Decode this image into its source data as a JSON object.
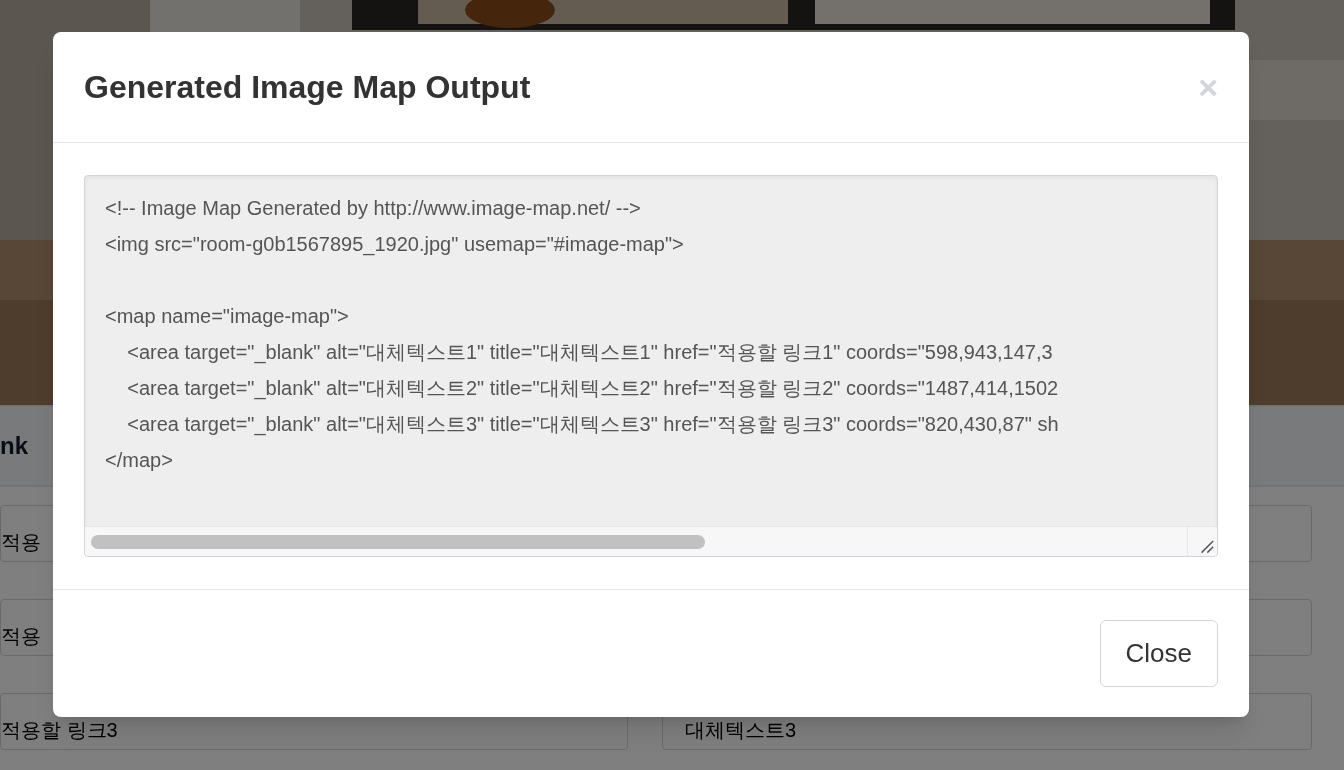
{
  "page": {
    "heading": "nk",
    "rows": [
      {
        "link": "적용",
        "alt": ""
      },
      {
        "link": "적용",
        "alt": ""
      },
      {
        "link": "적용할 링크3",
        "alt": "대체텍스트3"
      }
    ]
  },
  "modal": {
    "title": "Generated Image Map Output",
    "close_icon": "×",
    "code_blocks": [
      [
        "<!-- Image Map Generated by http://www.image-map.net/ -->",
        "<img src=\"room-g0b1567895_1920.jpg\" usemap=\"#image-map\">"
      ],
      [
        "<map name=\"image-map\">",
        "    <area target=\"_blank\" alt=\"대체텍스트1\" title=\"대체텍스트1\" href=\"적용할 링크1\" coords=\"598,943,147,3",
        "    <area target=\"_blank\" alt=\"대체텍스트2\" title=\"대체텍스트2\" href=\"적용할 링크2\" coords=\"1487,414,1502",
        "    <area target=\"_blank\" alt=\"대체텍스트3\" title=\"대체텍스트3\" href=\"적용할 링크3\" coords=\"820,430,87\" sh",
        "</map>"
      ]
    ],
    "buttons": [
      "Close"
    ]
  }
}
